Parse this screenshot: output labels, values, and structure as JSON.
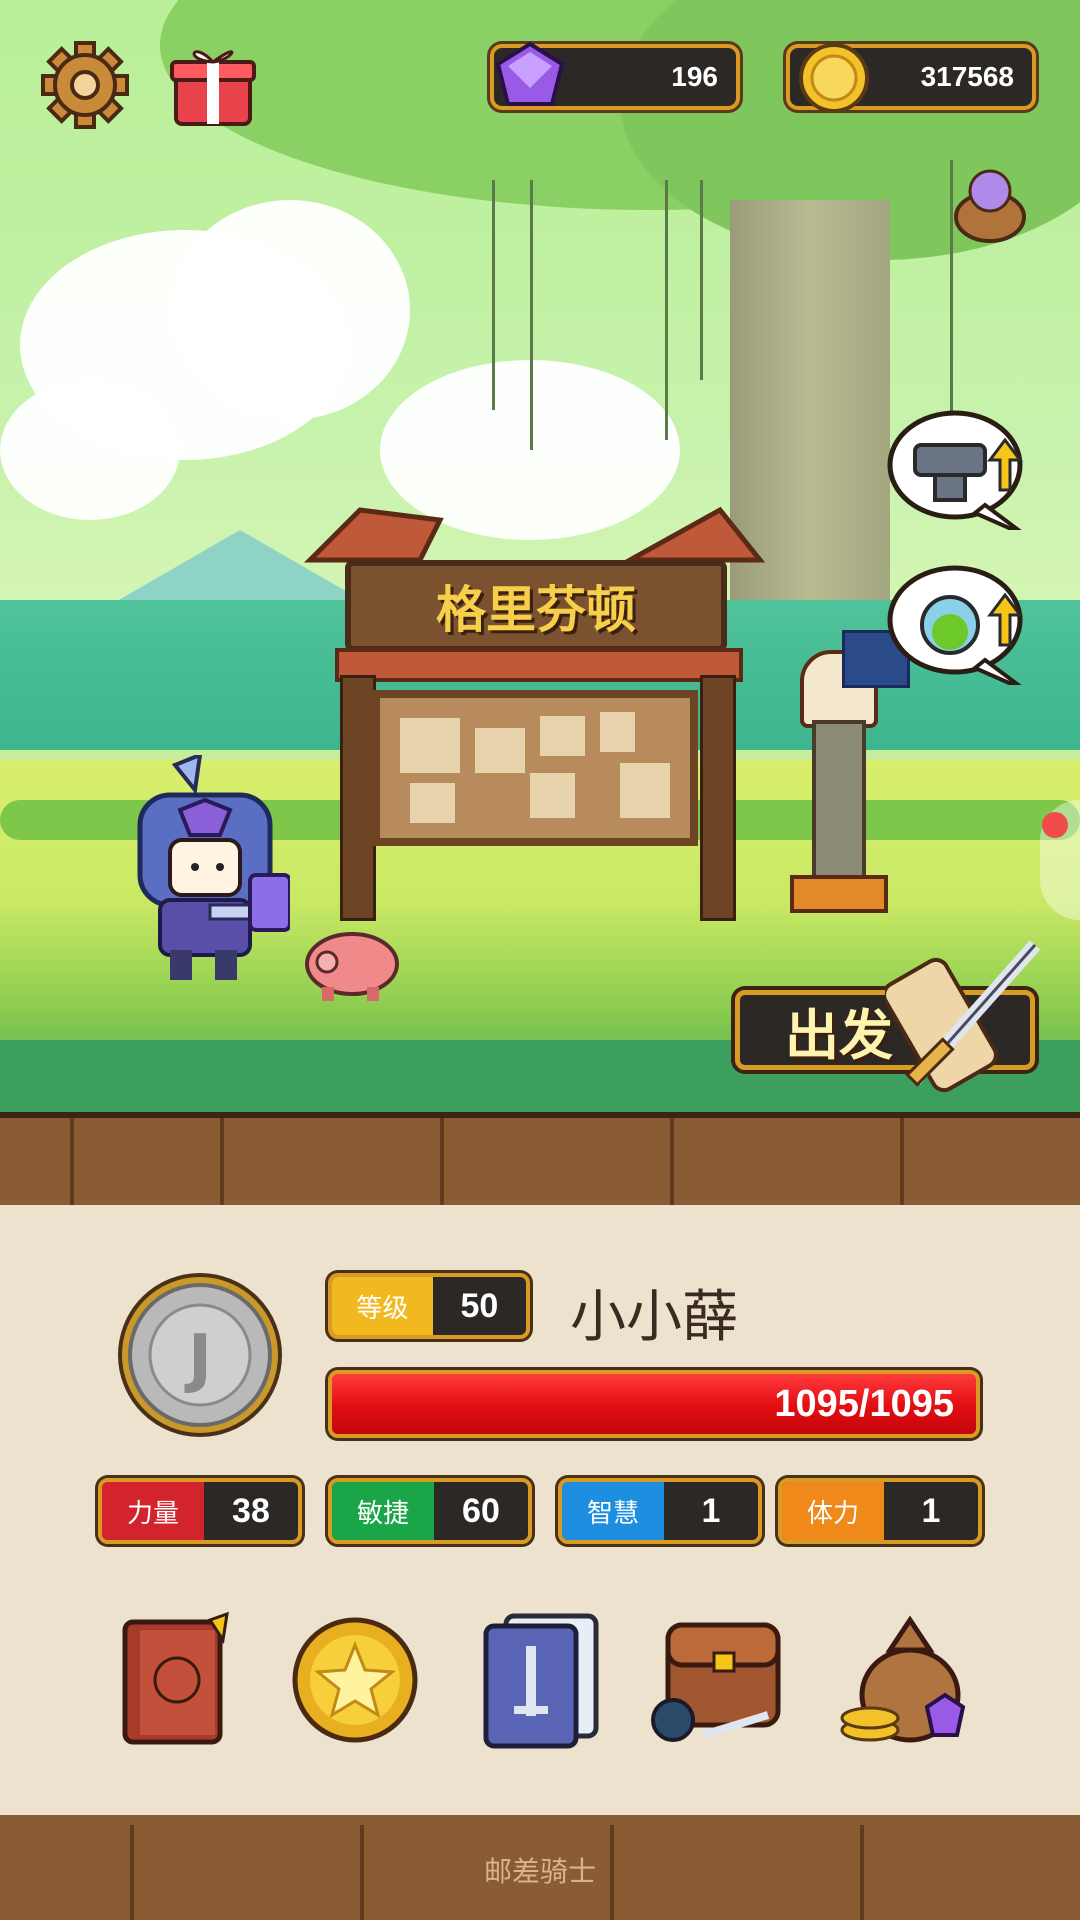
{
  "top": {
    "gems": "196",
    "coins": "317568",
    "settings_icon": "gear-icon",
    "gift_icon": "gift-icon"
  },
  "town": {
    "sign_name": "格里芬顿",
    "go_label": "出发"
  },
  "hero": {
    "level_label": "等级",
    "level": "50",
    "name": "小小薛",
    "hp_text": "1095/1095",
    "hp_fraction": 1.0
  },
  "stats": [
    {
      "label": "力量",
      "value": "38",
      "color": "#d3232c"
    },
    {
      "label": "敏捷",
      "value": "60",
      "color": "#1aa548"
    },
    {
      "label": "智慧",
      "value": "1",
      "color": "#1e8fe0"
    },
    {
      "label": "体力",
      "value": "1",
      "color": "#ef8a1a"
    }
  ],
  "bottom_icons": [
    "hero-book-icon",
    "star-coin-icon",
    "skill-cards-icon",
    "backpack-icon",
    "treasure-bag-icon"
  ],
  "footer": "邮差骑士",
  "colors": {
    "accent": "#d99b24",
    "panel": "#ece2cd",
    "dark": "#2c2826"
  }
}
